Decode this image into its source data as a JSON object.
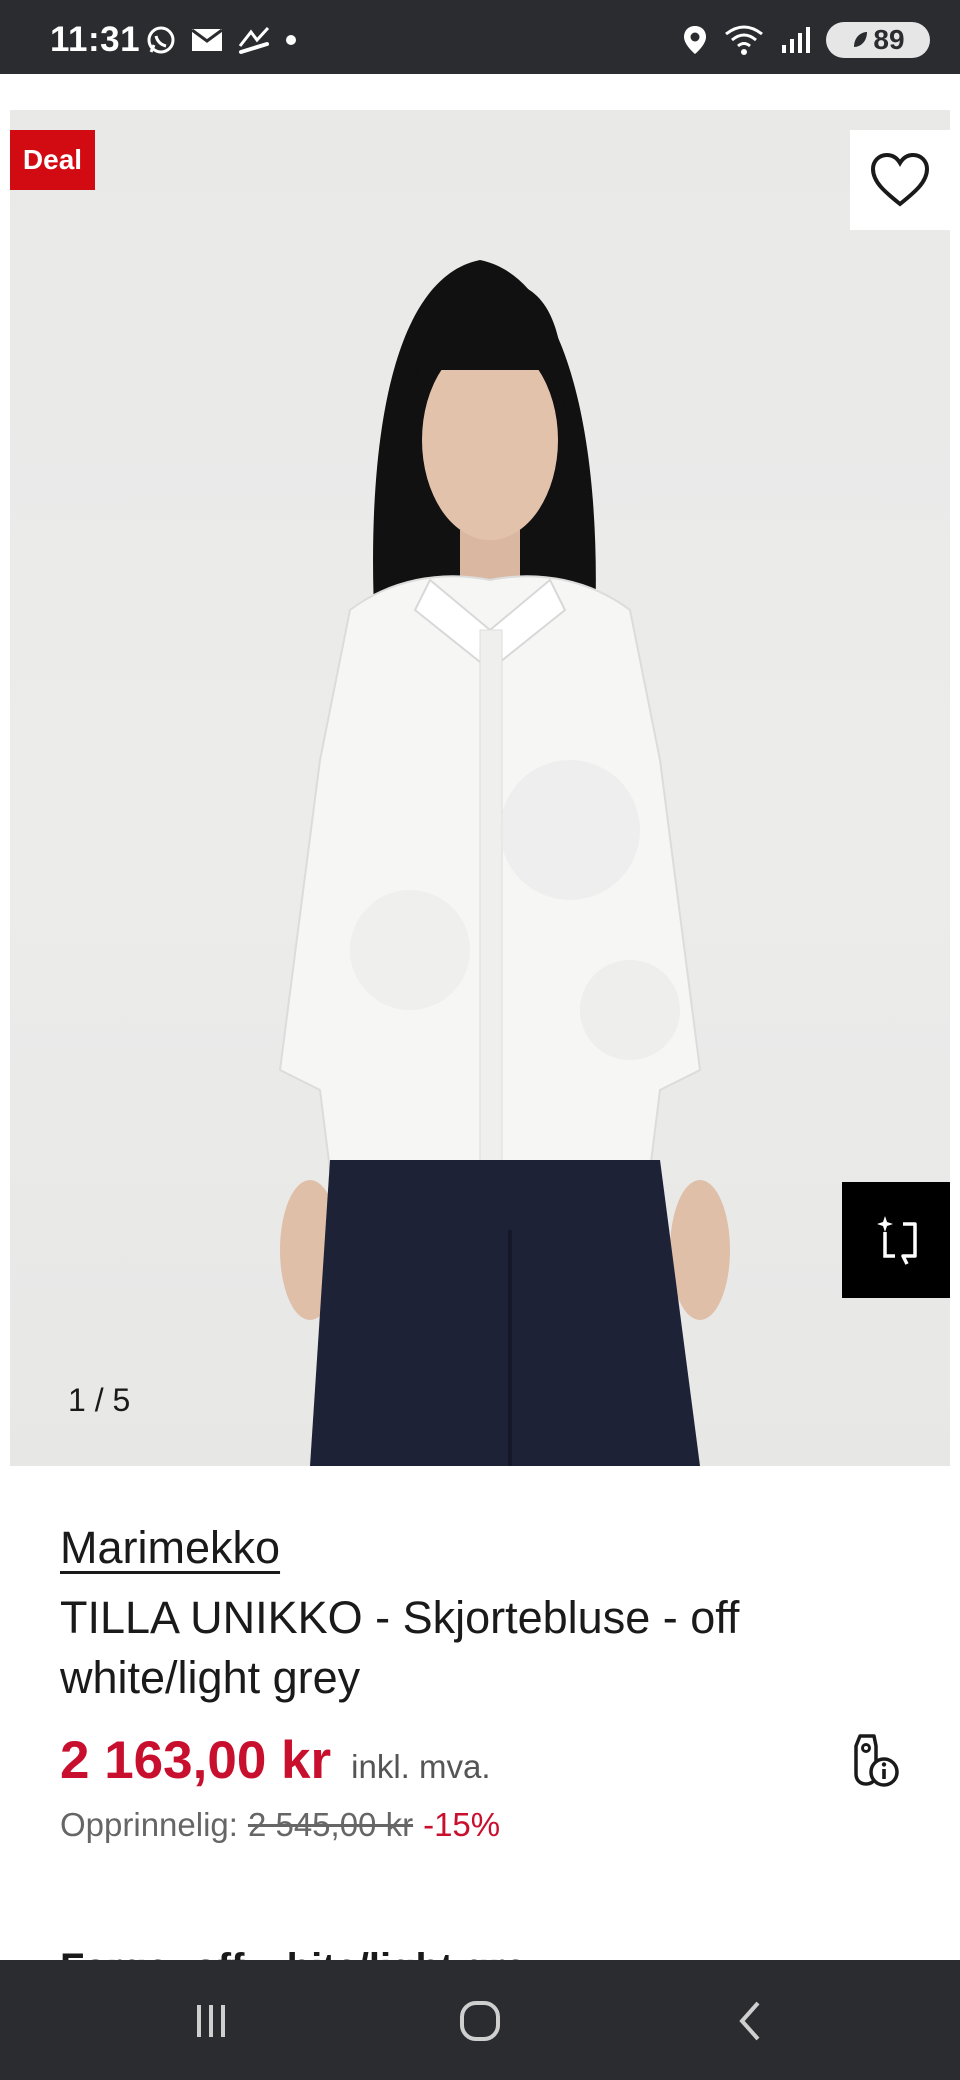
{
  "status_bar": {
    "time": "11:31",
    "left_icons": [
      "whatsapp-icon",
      "mail-icon",
      "missed-call-icon",
      "dot-icon"
    ],
    "right_icons": [
      "location-icon",
      "wifi-icon",
      "signal-icon"
    ],
    "battery": "89"
  },
  "gallery": {
    "deal_label": "Deal",
    "counter": "1 / 5",
    "wishlist_icon": "heart-icon",
    "vto_icon": "virtual-try-on-icon"
  },
  "product": {
    "brand": "Marimekko",
    "title": "TILLA UNIKKO - Skjortebluse - off white/light grey",
    "price": "2 163,00 kr",
    "vat_note": "inkl. mva.",
    "original_label": "Opprinnelig:",
    "original_price": "2 545,00 kr",
    "discount": "-15%",
    "price_info_icon": "price-tag-info-icon",
    "next_section_partial": "Farge: off white/light grey"
  },
  "colors": {
    "accent_red": "#d20a11",
    "price_red": "#c8102e",
    "system_bar": "#2b2c30"
  },
  "nav_bar": {
    "icons": [
      "recent-apps-icon",
      "home-icon",
      "back-icon"
    ]
  }
}
